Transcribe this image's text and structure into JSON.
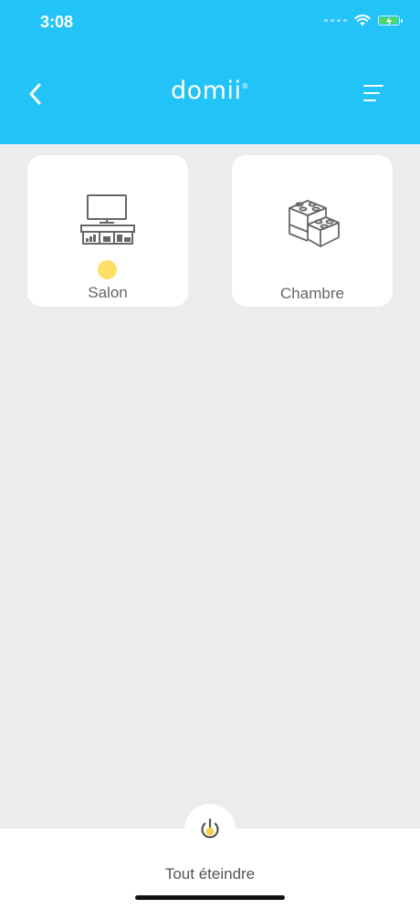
{
  "status_bar": {
    "time": "3:08"
  },
  "header": {
    "logo": "domii"
  },
  "rooms": [
    {
      "label": "Salon",
      "icon": "tv-stand-icon",
      "active": true
    },
    {
      "label": "Chambre",
      "icon": "lego-bricks-icon",
      "active": false
    }
  ],
  "footer": {
    "label": "Tout éteindre",
    "icon": "power-icon"
  },
  "colors": {
    "header_bg": "#22c3f7",
    "page_bg": "#ececec",
    "active_dot": "#fde068",
    "power_accent": "#f6d04d"
  }
}
